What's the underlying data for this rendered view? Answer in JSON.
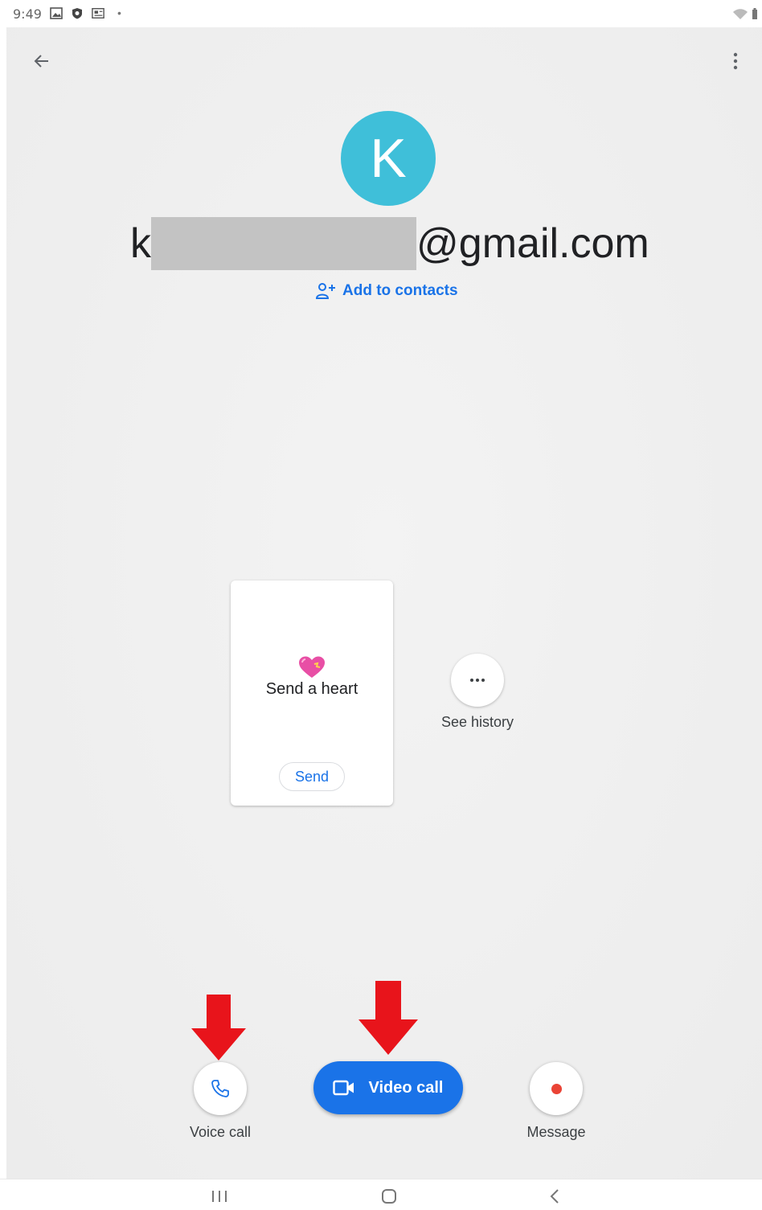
{
  "status_bar": {
    "time": "9:49",
    "icons": [
      "gallery-icon",
      "shield-icon",
      "news-icon",
      "wifi-icon",
      "battery-icon"
    ]
  },
  "header": {
    "back_icon": "arrow-left-icon",
    "menu_icon": "more-vert-icon"
  },
  "contact": {
    "avatar_letter": "K",
    "avatar_color": "#3fbfd9",
    "email_prefix": "k",
    "email_suffix": "@gmail.com",
    "add_to_contacts": "Add to contacts"
  },
  "heart_card": {
    "label": "Send a heart",
    "send": "Send"
  },
  "history": {
    "label": "See history"
  },
  "actions": {
    "voice_call": "Voice call",
    "video_call": "Video call",
    "message": "Message"
  },
  "colors": {
    "accent": "#1a73e8",
    "arrow": "#e8141b",
    "message_dot": "#ea4335"
  },
  "nav": {
    "icons": [
      "recent-apps-icon",
      "home-icon",
      "back-icon"
    ]
  }
}
